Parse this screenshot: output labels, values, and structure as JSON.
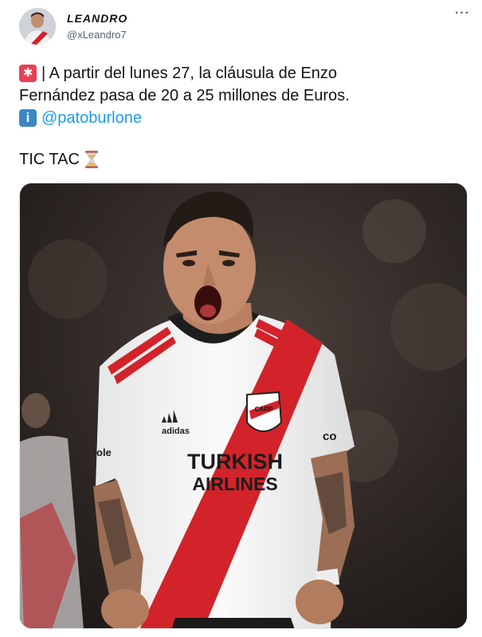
{
  "tweet": {
    "display_name": "LEANDRO",
    "handle": "@xLeandro7",
    "more_label": "···",
    "line1": "| A partir del lunes 27, la cláusula de Enzo",
    "line2": "Fernández pasa de 20 a 25 millones de Euros.",
    "mention": "@patoburlone",
    "tic_tac": "TIC TAC",
    "info_glyph": "i",
    "icons": {
      "alert": "police-siren-emoji",
      "info": "information-emoji",
      "timer": "hourglass-emoji"
    }
  },
  "photo": {
    "jersey_sponsor_line1": "TURKISH",
    "jersey_sponsor_line2": "AIRLINES",
    "jersey_brand": "adidas",
    "jersey_partial_right": "co",
    "jersey_partial_left": "ole",
    "colors": {
      "stripe": "#d2232a",
      "shirt": "#f4f4f4",
      "skin": "#c08a6a",
      "hair": "#231b16",
      "background": "#3a3330"
    }
  }
}
